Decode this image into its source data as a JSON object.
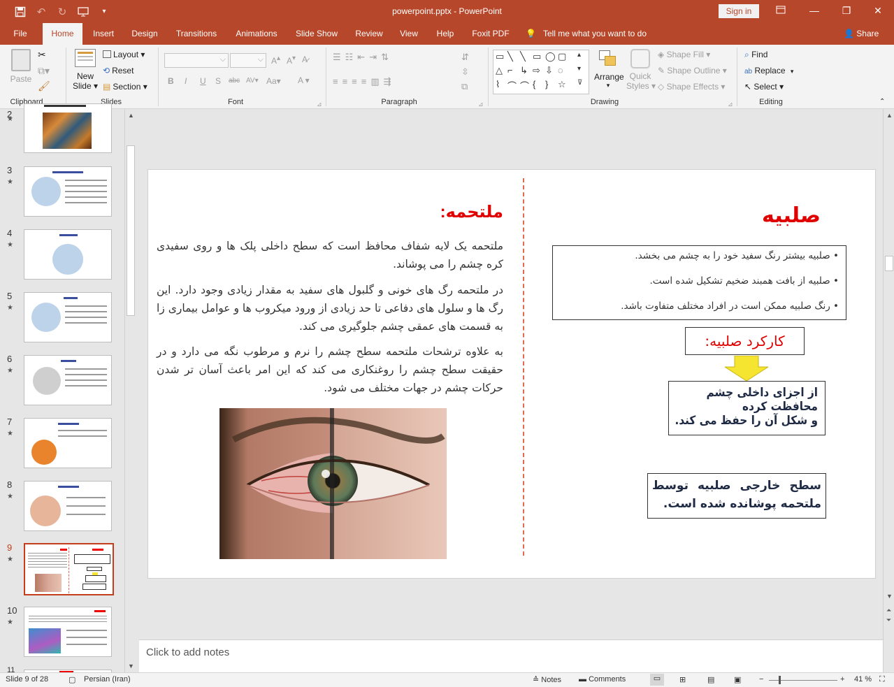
{
  "window": {
    "title": "powerpoint.pptx  -  PowerPoint",
    "sign_in": "Sign in"
  },
  "tabs": [
    "File",
    "Home",
    "Insert",
    "Design",
    "Transitions",
    "Animations",
    "Slide Show",
    "Review",
    "View",
    "Help",
    "Foxit PDF"
  ],
  "active_tab": "Home",
  "tell_me": "Tell me what you want to do",
  "share": "Share",
  "ribbon": {
    "clipboard": {
      "label": "Clipboard",
      "paste": "Paste"
    },
    "slides": {
      "label": "Slides",
      "new_slide_1": "New",
      "new_slide_2": "Slide",
      "layout": "Layout",
      "reset": "Reset",
      "section": "Section"
    },
    "font": {
      "label": "Font"
    },
    "paragraph": {
      "label": "Paragraph"
    },
    "drawing": {
      "label": "Drawing",
      "arrange": "Arrange",
      "quick_styles_1": "Quick",
      "quick_styles_2": "Styles",
      "shape_fill": "Shape Fill",
      "shape_outline": "Shape Outline",
      "shape_effects": "Shape Effects"
    },
    "editing": {
      "label": "Editing",
      "find": "Find",
      "replace": "Replace",
      "select": "Select"
    }
  },
  "thumbnails": [
    {
      "num": "2"
    },
    {
      "num": "3"
    },
    {
      "num": "4"
    },
    {
      "num": "5"
    },
    {
      "num": "6"
    },
    {
      "num": "7"
    },
    {
      "num": "8"
    },
    {
      "num": "9"
    },
    {
      "num": "10"
    },
    {
      "num": "11"
    }
  ],
  "selected_slide": "9",
  "slide": {
    "conjunctiva_title": "ملتحمه:",
    "conjunctiva_p1": "ملتحمه یک لایه شفاف محافظ است که سطح داخلی پلک ها و روی سفیدی کره چشم را می پوشاند.",
    "conjunctiva_p2": "در ملتحمه رگ های خونی و گلبول های سفید به مقدار زیادی وجود دارد. این رگ ها و سلول های دفاعی تا حد زیادی از ورود میکروب ها و عوامل بیماری زا به قسمت های عمقی چشم جلوگیری می کند.",
    "conjunctiva_p3": "به علاوه ترشحات ملتحمه سطح چشم را نرم و مرطوب نگه می دارد و در حقیقت سطح چشم را روغنکاری می کند که این امر باعث آسان تر شدن حرکات چشم در جهات مختلف می شود.",
    "sclera_title": "صلبیه",
    "sclera_bullets": [
      "صلبیه بیشتر رنگ سفید خود را به چشم می بخشد.",
      "صلبیه از بافت همبند ضخیم تشکیل شده است.",
      "رنگ صلبیه ممکن است در افراد مختلف متفاوت باشد."
    ],
    "function_title": "کارکرد صلبیه:",
    "function_line1": "از اجزای داخلی چشم محافظت کرده",
    "function_line2": "و شکل آن را حفظ می کند.",
    "surface_text": "سطح خارجی صلبیه توسط ملتحمه پوشانده شده است."
  },
  "notes_placeholder": "Click to add notes",
  "status": {
    "slide_info": "Slide 9 of 28",
    "language": "Persian (Iran)",
    "notes": "Notes",
    "comments": "Comments",
    "zoom": "41 %"
  }
}
